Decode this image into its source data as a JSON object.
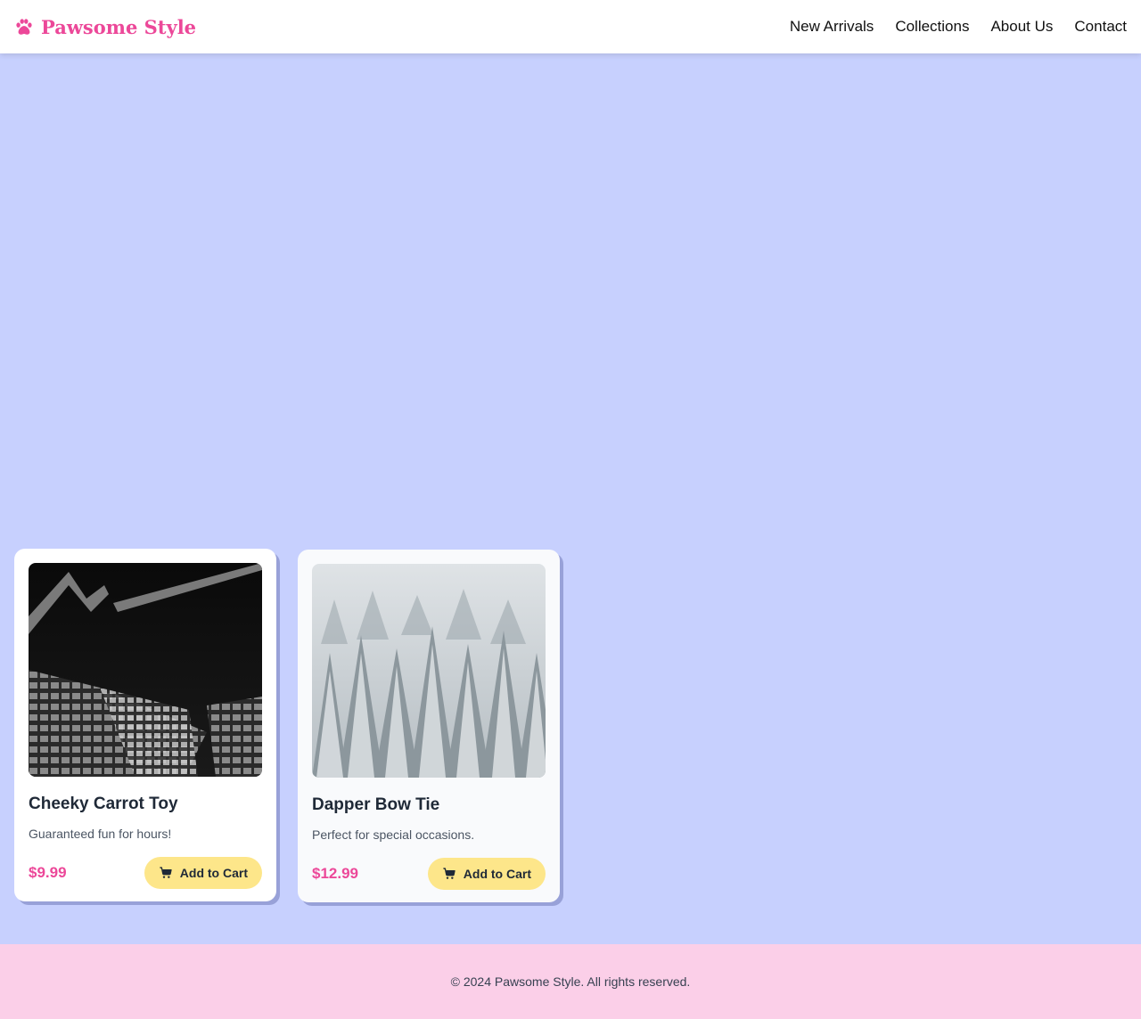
{
  "header": {
    "brand": "Pawsome Style",
    "nav": [
      "New Arrivals",
      "Collections",
      "About Us",
      "Contact"
    ]
  },
  "products": [
    {
      "name": "Cheeky Carrot Toy",
      "description": "Guaranteed fun for hours!",
      "price": "$9.99",
      "button": "Add to Cart",
      "image_icon": "building-photo"
    },
    {
      "name": "Dapper Bow Tie",
      "description": "Perfect for special occasions.",
      "price": "$12.99",
      "button": "Add to Cart",
      "image_icon": "snowy-forest-photo"
    }
  ],
  "footer": {
    "text": "© 2024 Pawsome Style. All rights reserved."
  },
  "colors": {
    "brand": "#ec4899",
    "background": "#c7d0fe",
    "button": "#fde68a",
    "footer": "#fbcfe8"
  }
}
